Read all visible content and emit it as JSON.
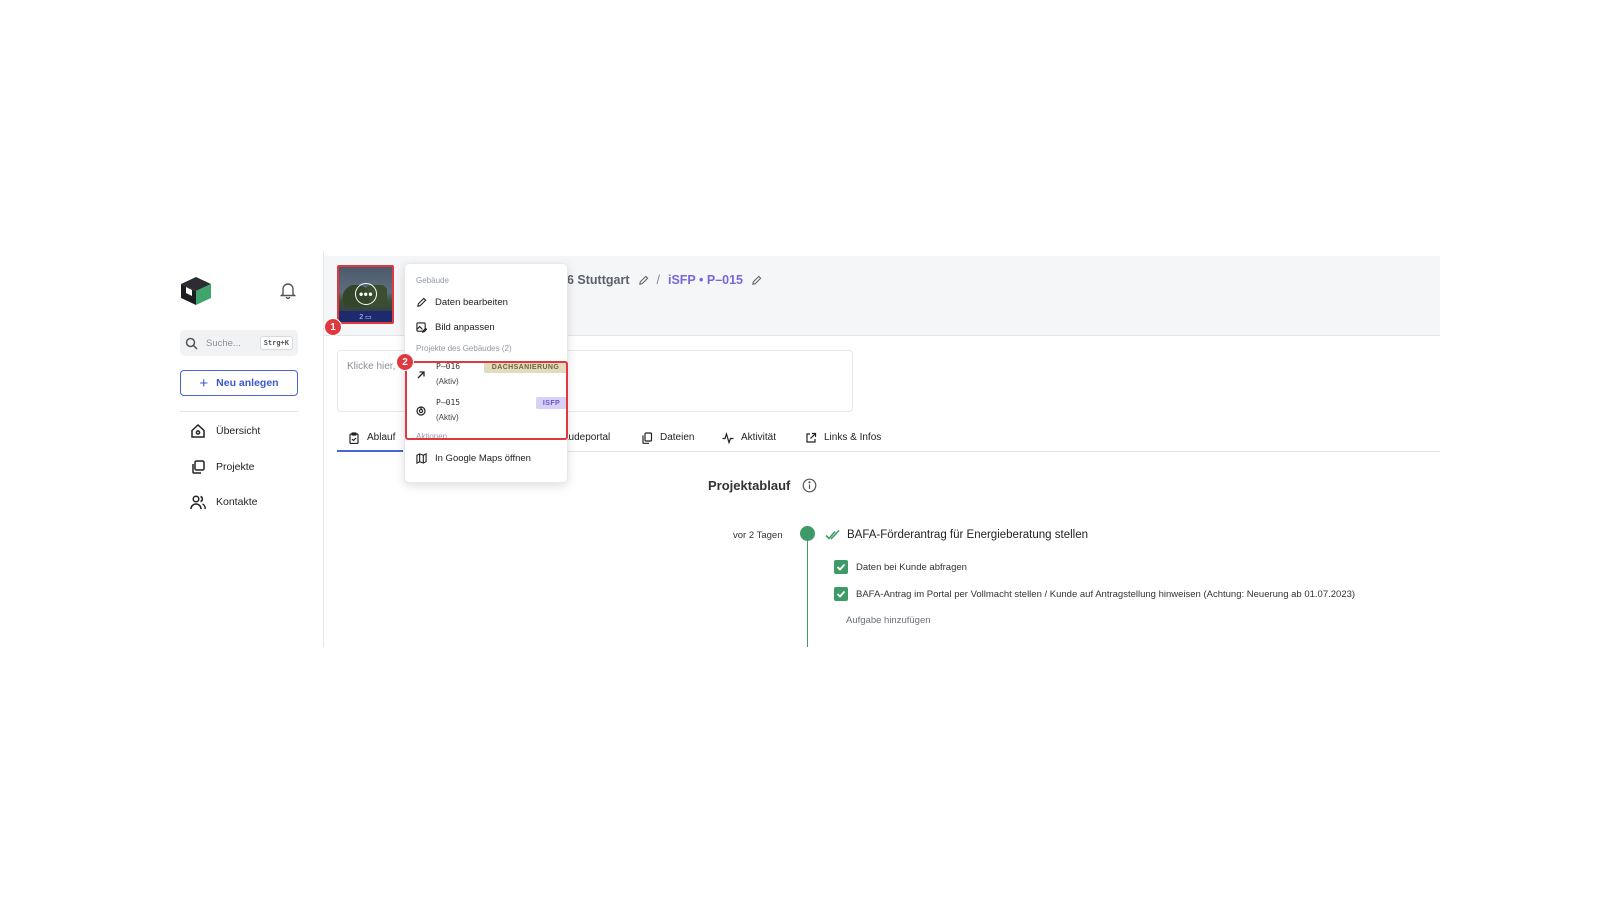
{
  "sidebar": {
    "search_placeholder": "Suche...",
    "search_shortcut": "Strg+K",
    "new_button": "Neu anlegen",
    "nav": [
      {
        "label": "Übersicht",
        "icon": "home-icon"
      },
      {
        "label": "Projekte",
        "icon": "projects-icon"
      },
      {
        "label": "Kontakte",
        "icon": "contacts-icon"
      }
    ]
  },
  "header": {
    "location": "6 Stuttgart",
    "separator": "/",
    "project": "iSFP • P–015",
    "image_count": "2"
  },
  "annotations": {
    "one": "1",
    "two": "2"
  },
  "note_placeholder": "Klicke hier,",
  "tabs": [
    "Ablauf",
    "äudeportal",
    "Dateien",
    "Aktivität",
    "Links & Infos"
  ],
  "timeline": {
    "title": "Projektablauf",
    "time": "vor 2 Tagen",
    "task": "BAFA-Förderantrag für Energieberatung stellen",
    "subtasks": [
      "Daten bei Kunde abfragen",
      "BAFA-Antrag im Portal per Vollmacht stellen / Kunde auf Antragstellung hinweisen (Achtung: Neuerung ab 01.07.2023)"
    ],
    "add_task": "Aufgabe hinzufügen"
  },
  "menu": {
    "section_building": "Gebäude",
    "edit_data": "Daten bearbeiten",
    "adjust_image": "Bild anpassen",
    "section_projects": "Projekte des Gebäudes (2)",
    "projects": [
      {
        "id": "P–016",
        "status": "(Aktiv)",
        "tag": "DACHSANIERUNG"
      },
      {
        "id": "P–015",
        "status": "(Aktiv)",
        "tag": "ISFP"
      }
    ],
    "section_actions": "Aktionen",
    "google_maps": "In Google Maps öffnen"
  },
  "colors": {
    "accent_blue": "#4a66d6",
    "project_purple": "#7a66d8",
    "success_green": "#3e9b68",
    "highlight_red": "#e0383e"
  }
}
